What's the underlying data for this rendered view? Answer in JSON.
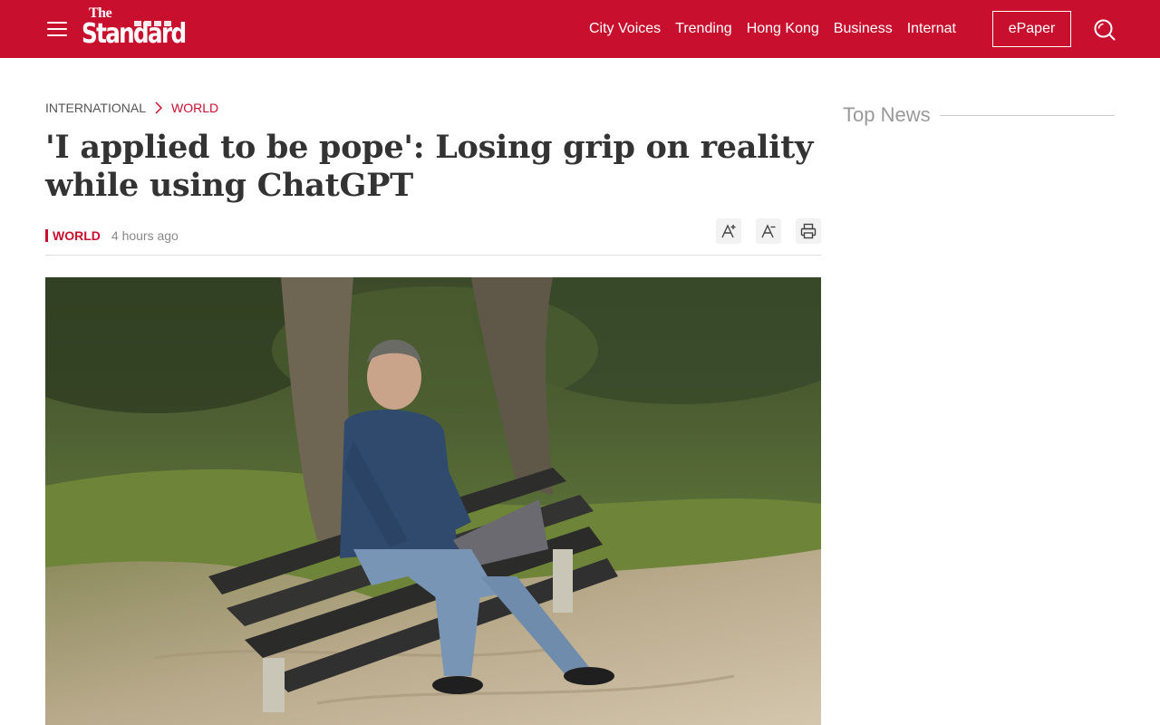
{
  "header": {
    "logo": {
      "the": "The",
      "main": "Standard"
    },
    "nav": [
      "City Voices",
      "Trending",
      "Hong Kong",
      "Business",
      "Internat"
    ],
    "epaper_label": "ePaper",
    "colors": {
      "brand": "#c8102e"
    }
  },
  "breadcrumb": {
    "section": "INTERNATIONAL",
    "subsection": "WORLD"
  },
  "article": {
    "headline": "'I applied to be pope': Losing grip on reality while using ChatGPT",
    "category": "WORLD",
    "time": "4 hours ago",
    "tools": [
      "font-increase-icon",
      "font-decrease-icon",
      "print-icon"
    ]
  },
  "sidebar": {
    "top_news_label": "Top News"
  }
}
